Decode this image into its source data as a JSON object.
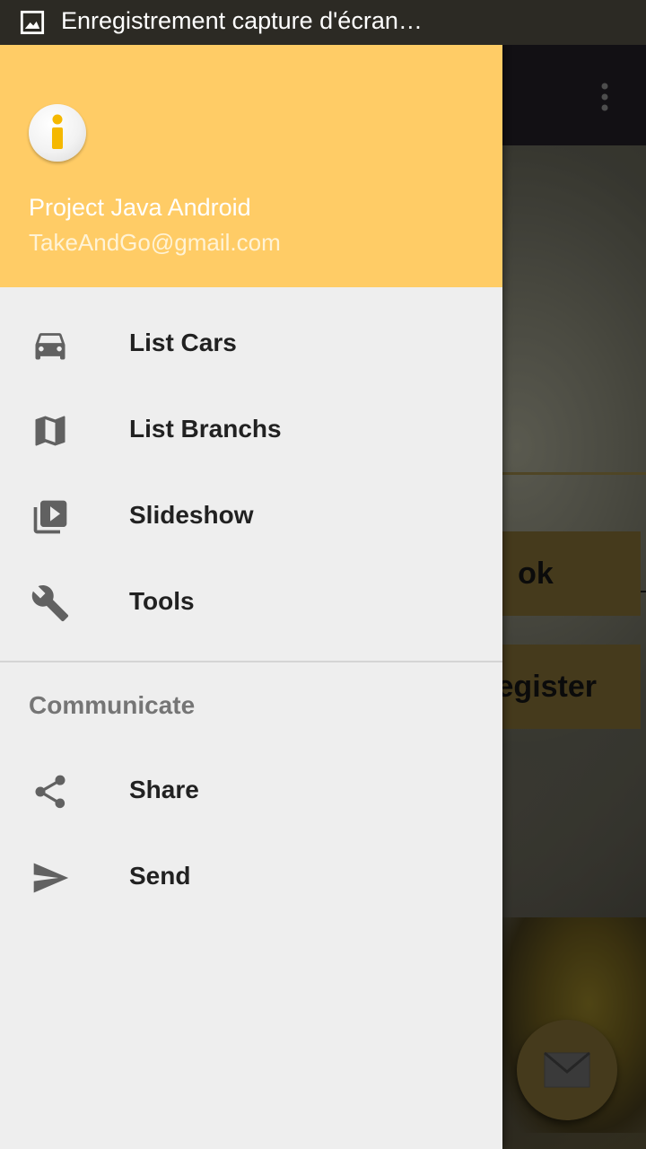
{
  "status_bar": {
    "notification_text": "Enregistrement capture d'écran…",
    "notification_icon": "image-icon"
  },
  "drawer": {
    "header": {
      "title": "Project Java Android",
      "email": "TakeAndGo@gmail.com",
      "avatar_icon": "info-icon",
      "background_color": "#ffcc66"
    },
    "items": [
      {
        "label": "List Cars",
        "icon": "car-icon"
      },
      {
        "label": "List Branchs",
        "icon": "map-icon"
      },
      {
        "label": "Slideshow",
        "icon": "slideshow-icon"
      },
      {
        "label": "Tools",
        "icon": "wrench-icon"
      }
    ],
    "section_title": "Communicate",
    "communicate_items": [
      {
        "label": "Share",
        "icon": "share-icon"
      },
      {
        "label": "Send",
        "icon": "send-icon"
      }
    ]
  },
  "background_app": {
    "ok_label": "ok",
    "register_label": "Register",
    "fab_icon": "mail-icon",
    "accent_color": "#6b5a2c"
  }
}
